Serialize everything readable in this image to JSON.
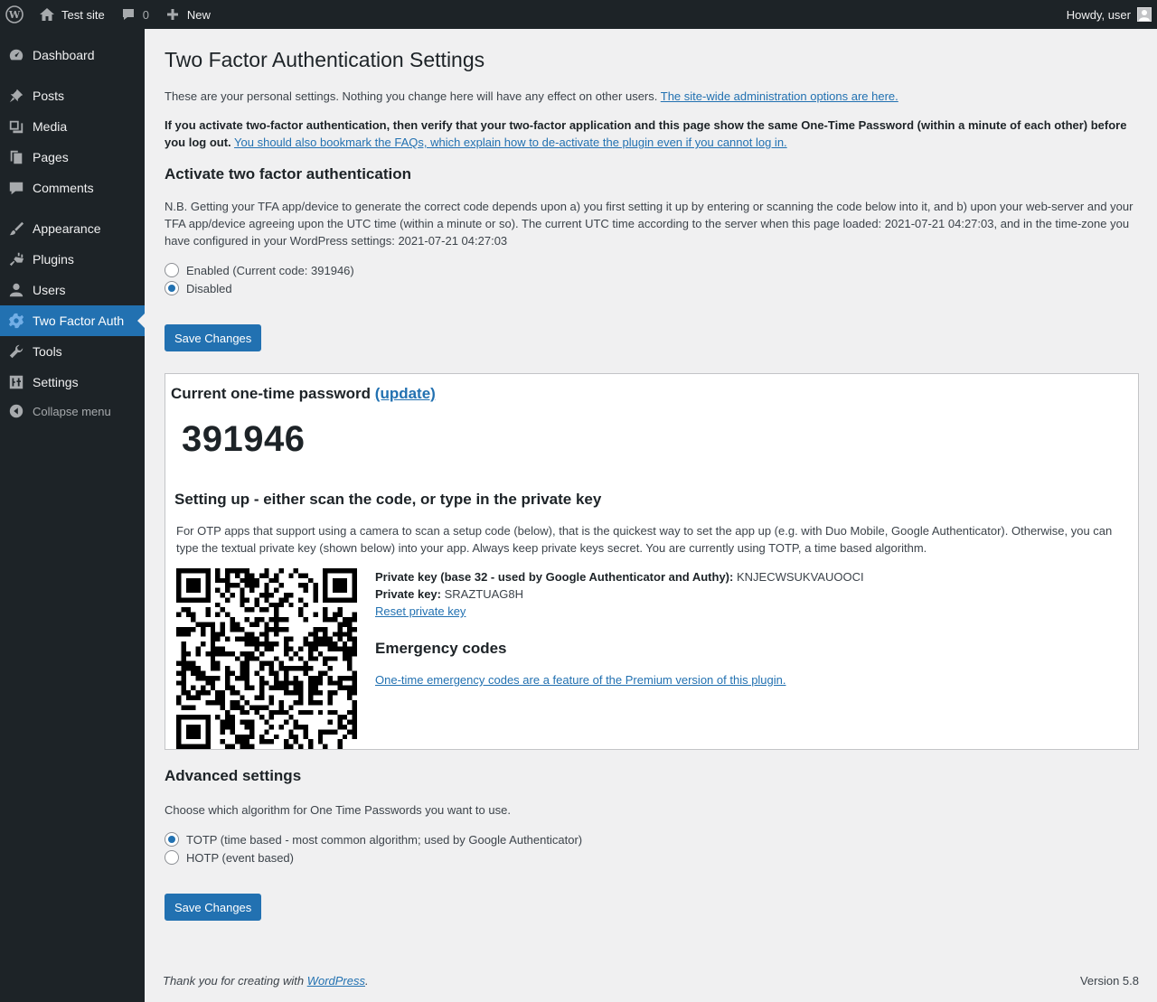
{
  "adminbar": {
    "site_name": "Test site",
    "comments_count": "0",
    "new_label": "New",
    "greeting": "Howdy, user"
  },
  "sidebar": {
    "items": [
      {
        "label": "Dashboard",
        "icon": "dashboard-icon"
      },
      {
        "label": "Posts",
        "icon": "pin-icon"
      },
      {
        "label": "Media",
        "icon": "media-icon"
      },
      {
        "label": "Pages",
        "icon": "pages-icon"
      },
      {
        "label": "Comments",
        "icon": "comment-icon"
      },
      {
        "label": "Appearance",
        "icon": "brush-icon"
      },
      {
        "label": "Plugins",
        "icon": "plugin-icon"
      },
      {
        "label": "Users",
        "icon": "user-icon"
      },
      {
        "label": "Two Factor Auth",
        "icon": "gear-icon"
      },
      {
        "label": "Tools",
        "icon": "wrench-icon"
      },
      {
        "label": "Settings",
        "icon": "settings-icon"
      }
    ],
    "collapse_label": "Collapse menu"
  },
  "page": {
    "title": "Two Factor Authentication Settings",
    "intro_text": "These are your personal settings. Nothing you change here will have any effect on other users.",
    "intro_link": "The site-wide administration options are here.",
    "warning_bold": "If you activate two-factor authentication, then verify that your two-factor application and this page show the same One-Time Password (within a minute of each other) before you log out.",
    "warning_link": "You should also bookmark the FAQs, which explain how to de-activate the plugin even if you cannot log in.",
    "activate_heading": "Activate two factor authentication",
    "nb_text": "N.B. Getting your TFA app/device to generate the correct code depends upon a) you first setting it up by entering or scanning the code below into it, and b) upon your web-server and your TFA app/device agreeing upon the UTC time (within a minute or so). The current UTC time according to the server when this page loaded: 2021-07-21 04:27:03, and in the time-zone you have configured in your WordPress settings: 2021-07-21 04:27:03",
    "enabled_label": "Enabled (Current code: 391946)",
    "disabled_label": "Disabled",
    "save_label": "Save Changes",
    "otp_heading": "Current one-time password",
    "otp_update": "(update)",
    "otp_code": "391946",
    "setup_heading": "Setting up - either scan the code, or type in the private key",
    "setup_text": "For OTP apps that support using a camera to scan a setup code (below), that is the quickest way to set the app up (e.g. with Duo Mobile, Google Authenticator). Otherwise, you can type the textual private key (shown below) into your app. Always keep private keys secret. You are currently using TOTP, a time based algorithm.",
    "key32_label": "Private key (base 32 - used by Google Authenticator and Authy):",
    "key32_value": "KNJECWSUKVAUOOCI",
    "key_label": "Private key:",
    "key_value": "SRAZTUAG8H",
    "reset_link": "Reset private key",
    "emergency_heading": "Emergency codes",
    "emergency_link": "One-time emergency codes are a feature of the Premium version of this plugin.",
    "advanced_heading": "Advanced settings",
    "algo_text": "Choose which algorithm for One Time Passwords you want to use.",
    "totp_label": "TOTP (time based - most common algorithm; used by Google Authenticator)",
    "hotp_label": "HOTP (event based)",
    "save_label_2": "Save Changes"
  },
  "footer": {
    "thanks_prefix": "Thank you for creating with",
    "thanks_link": "WordPress",
    "thanks_suffix": ".",
    "version": "Version 5.8"
  },
  "colors": {
    "accent": "#2271b1",
    "sidebar_bg": "#1d2327",
    "content_bg": "#f0f0f1"
  }
}
